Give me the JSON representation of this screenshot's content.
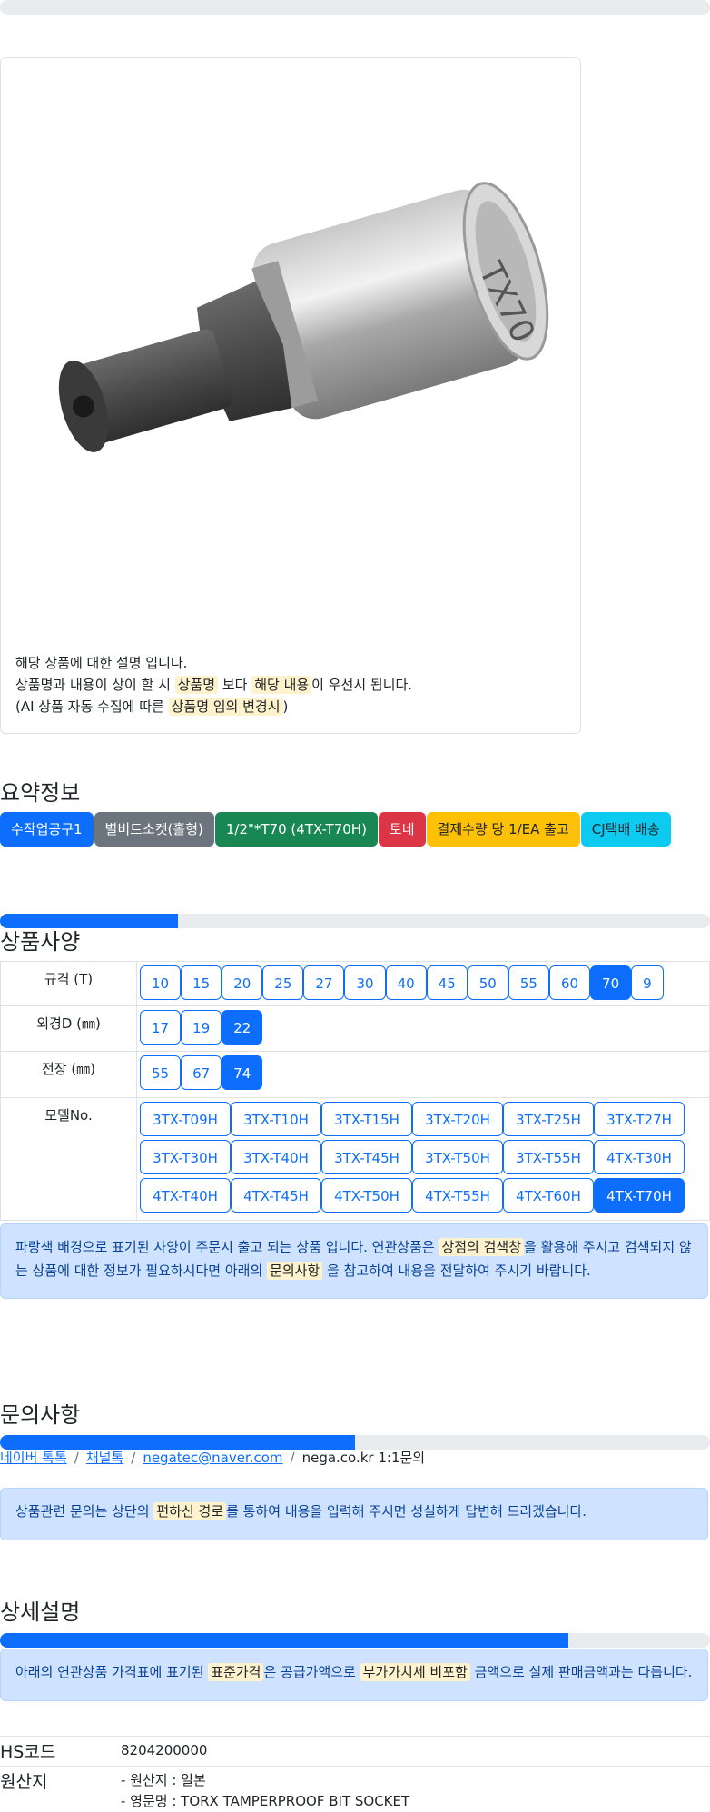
{
  "notes": {
    "line1": "해당 상품에 대한 설명 입니다.",
    "line2_a": "상품명과 내용이 상이 할 시 ",
    "line2_hl1": "상품명",
    "line2_b": " 보다 ",
    "line2_hl2": "해당 내용",
    "line2_c": "이 우선시 됩니다.",
    "line3_a": "(AI 상품 자동 수집에 따른 ",
    "line3_hl": "상품명 임의 변경시",
    "line3_b": ")"
  },
  "summary": {
    "title": "요약정보",
    "badges": [
      {
        "label": "수작업공구1",
        "bg": "#0d6efd",
        "fg": "#ffffff"
      },
      {
        "label": "별비트소켓(홀형)",
        "bg": "#6c757d",
        "fg": "#ffffff"
      },
      {
        "label": "1/2\"*T70 (4TX-T70H)",
        "bg": "#198754",
        "fg": "#ffffff"
      },
      {
        "label": "토네",
        "bg": "#dc3545",
        "fg": "#ffffff"
      },
      {
        "label": "결제수량 당 1/EA 출고",
        "bg": "#ffc107",
        "fg": "#212529"
      },
      {
        "label": "CJ택배 배송",
        "bg": "#0dcaf0",
        "fg": "#212529"
      }
    ]
  },
  "spec": {
    "title": "상품사양",
    "progress": 0.25,
    "rows": {
      "size_label": "규격 (T)",
      "size_opts": [
        "10",
        "15",
        "20",
        "25",
        "27",
        "30",
        "40",
        "45",
        "50",
        "55",
        "60",
        "70",
        "9"
      ],
      "size_selected": "70",
      "od_label": "외경D (㎜)",
      "od_opts": [
        "17",
        "19",
        "22"
      ],
      "od_selected": "22",
      "len_label": "전장 (㎜)",
      "len_opts": [
        "55",
        "67",
        "74"
      ],
      "len_selected": "74",
      "model_label": "모델No.",
      "model_opts": [
        "3TX-T09H",
        "3TX-T10H",
        "3TX-T15H",
        "3TX-T20H",
        "3TX-T25H",
        "3TX-T27H",
        "3TX-T30H",
        "3TX-T40H",
        "3TX-T45H",
        "3TX-T50H",
        "3TX-T55H",
        "4TX-T30H",
        "4TX-T40H",
        "4TX-T45H",
        "4TX-T50H",
        "4TX-T55H",
        "4TX-T60H",
        "4TX-T70H"
      ],
      "model_selected": "4TX-T70H"
    },
    "alert_a": "파랑색 배경으로 표기된 사양이 주문시 출고 되는 상품 입니다. 연관상품은 ",
    "alert_hl1": "상점의 검색창",
    "alert_b": "을 활용해 주시고 검색되지 않는 상품에 대한 정보가 필요하시다면 아래의 ",
    "alert_hl2": "문의사항",
    "alert_c": " 을 참고하여 내용을 전달하여 주시기 바랍니다."
  },
  "inquiry": {
    "title": "문의사항",
    "progress": 0.5,
    "link1": "네이버 톡톡",
    "link2": "채널톡",
    "link3": "negatec@naver.com",
    "text4": "nega.co.kr 1:1문의",
    "sep": "/",
    "alert_a": "상품관련 문의는 상단의 ",
    "alert_hl": "편하신 경로",
    "alert_b": "를 통하여 내용을 입력해 주시면 성실하게 답변해 드리겠습니다."
  },
  "detail": {
    "title": "상세설명",
    "progress": 0.8,
    "alert_a": "아래의 연관상품 가격표에 표기된 ",
    "alert_hl1": "표준가격",
    "alert_b": "은 공급가액으로 ",
    "alert_hl2": "부가가치세 비포함",
    "alert_c": " 금액으로 실제 판매금액과는 다릅니다.",
    "hs_label": "HS코드",
    "hs_value": "8204200000",
    "origin_label": "원산지",
    "origin_line1": "- 원산지 : 일본",
    "origin_line2": "- 영문명 : TORX TAMPERPROOF BIT SOCKET"
  }
}
